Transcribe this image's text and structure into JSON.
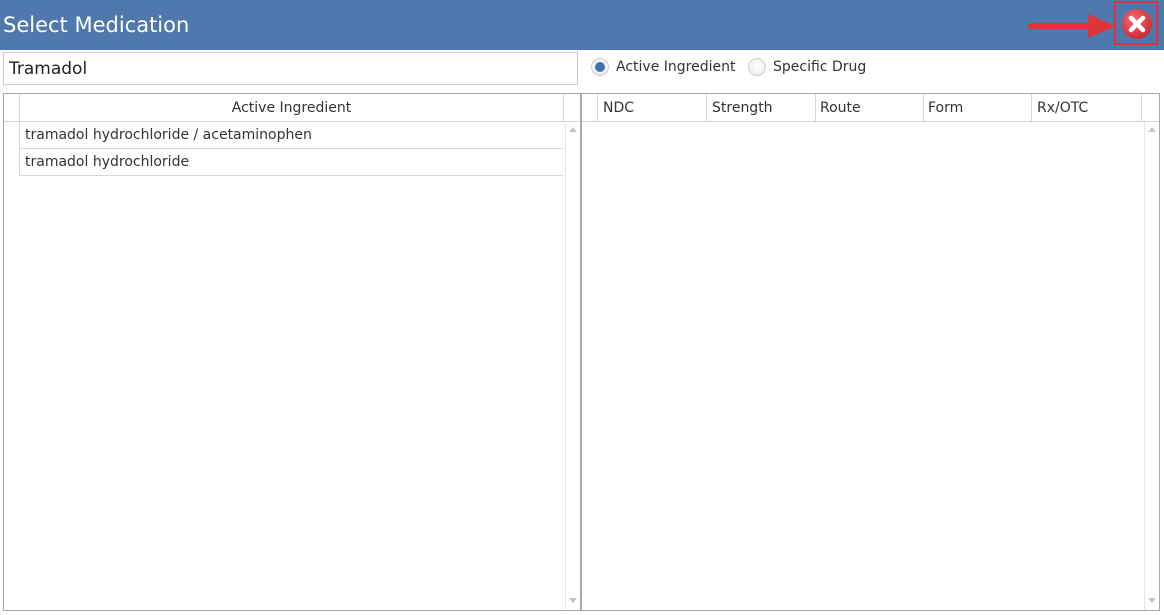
{
  "window": {
    "title": "Select Medication",
    "colors": {
      "titlebar": "#4f79ad",
      "close_button": "#e0343b",
      "annotation": "#e0343b",
      "radio_selected": "#3f6fb0"
    },
    "icons": {
      "close": "close-icon",
      "annotation": "arrow-right-icon"
    }
  },
  "search": {
    "value": "Tramadol"
  },
  "options": {
    "active_ingredient": "Active Ingredient",
    "specific_drug": "Specific Drug",
    "selected": "Active Ingredient"
  },
  "ingredients_table": {
    "header": "Active Ingredient",
    "rows": [
      "tramadol hydrochloride / acetaminophen",
      "tramadol hydrochloride"
    ]
  },
  "drugs_table": {
    "columns": [
      "NDC",
      "Strength",
      "Route",
      "Form",
      "Rx/OTC"
    ],
    "rows": []
  }
}
